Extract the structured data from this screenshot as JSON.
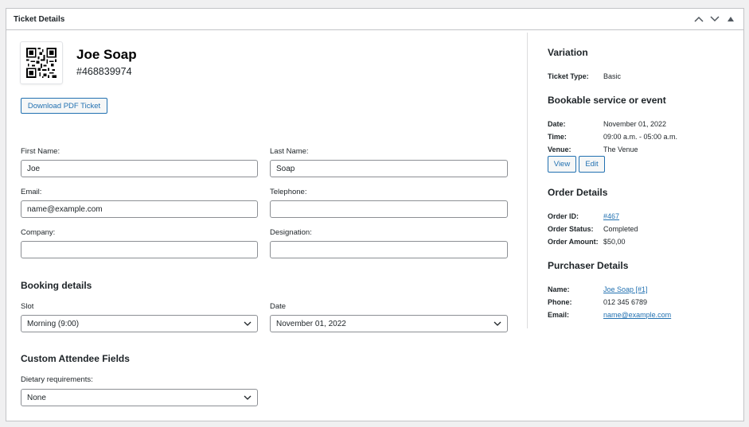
{
  "panel": {
    "title": "Ticket Details"
  },
  "attendee": {
    "name": "Joe Soap",
    "ticket_number": "#468839974",
    "download_label": "Download PDF Ticket"
  },
  "form": {
    "first_name": {
      "label": "First Name:",
      "value": "Joe"
    },
    "last_name": {
      "label": "Last Name:",
      "value": "Soap"
    },
    "email": {
      "label": "Email:",
      "value": "name@example.com"
    },
    "telephone": {
      "label": "Telephone:",
      "value": ""
    },
    "company": {
      "label": "Company:",
      "value": ""
    },
    "designation": {
      "label": "Designation:",
      "value": ""
    }
  },
  "booking": {
    "heading": "Booking details",
    "slot_label": "Slot",
    "slot_value": "Morning (9:00)",
    "date_label": "Date",
    "date_value": "November 01, 2022"
  },
  "custom_fields": {
    "heading": "Custom Attendee Fields",
    "dietary_label": "Dietary requirements:",
    "dietary_value": "None"
  },
  "sidebar": {
    "variation": {
      "heading": "Variation",
      "ticket_type_key": "Ticket Type:",
      "ticket_type_value": "Basic"
    },
    "bookable": {
      "heading": "Bookable service or event",
      "date_key": "Date:",
      "date_value": "November 01, 2022",
      "time_key": "Time:",
      "time_value": "09:00 a.m. - 05:00 a.m.",
      "venue_key": "Venue:",
      "venue_value": "The Venue",
      "view_label": "View",
      "edit_label": "Edit"
    },
    "order": {
      "heading": "Order Details",
      "id_key": "Order ID:",
      "id_value": "#467",
      "status_key": "Order Status:",
      "status_value": "Completed",
      "amount_key": "Order Amount:",
      "amount_value": "$50,00"
    },
    "purchaser": {
      "heading": "Purchaser Details",
      "name_key": "Name:",
      "name_value": "Joe Soap [#1]",
      "phone_key": "Phone:",
      "phone_value": "012 345 6789",
      "email_key": "Email:",
      "email_value": "name@example.com"
    }
  },
  "icons": {
    "move_up": "chevron-up-icon",
    "move_down": "chevron-down-icon",
    "toggle": "triangle-up-icon",
    "qr": "qr-code-icon"
  },
  "colors": {
    "accent": "#2271b1",
    "border": "#c3c4c7",
    "input_border": "#8c8f94"
  }
}
